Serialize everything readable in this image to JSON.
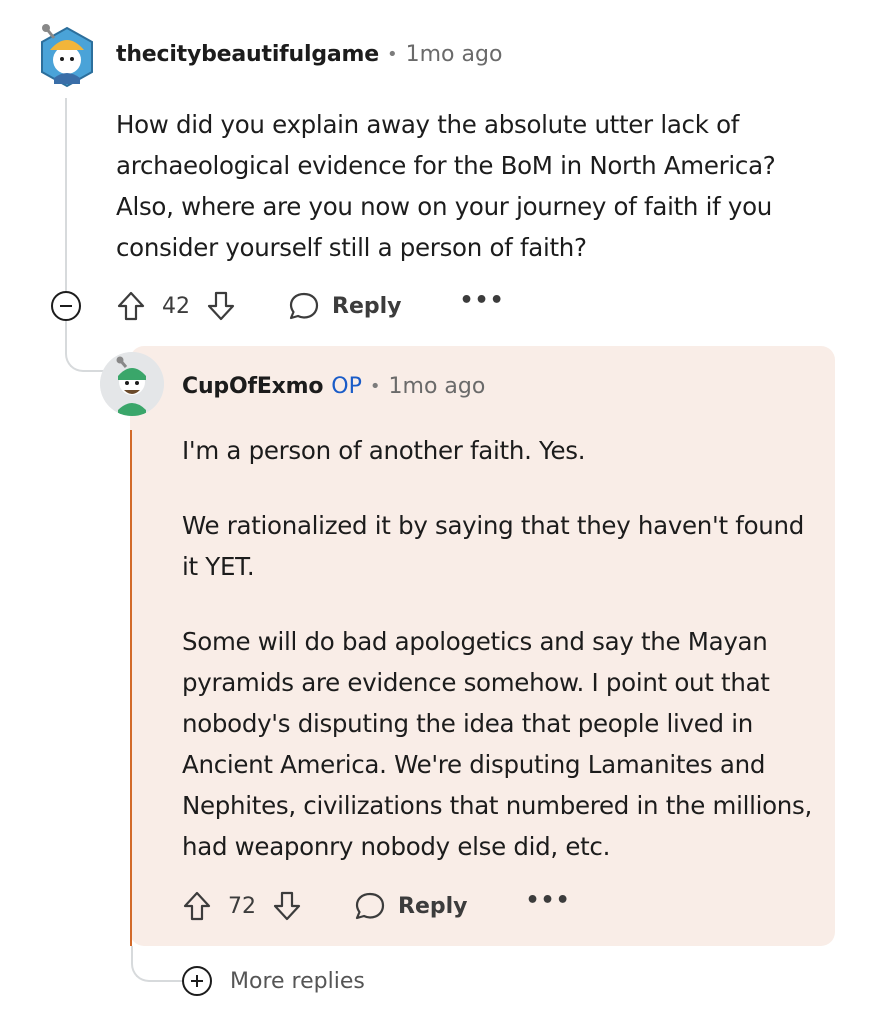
{
  "parent_comment": {
    "username": "thecitybeautifulgame",
    "timestamp": "1mo ago",
    "separator": "•",
    "body": [
      "How did you explain away the absolute utter lack of archaeological evidence for the BoM in North America? Also, where are you now on your journey of faith if you consider yourself still a person of faith?"
    ],
    "score": "42",
    "reply_label": "Reply",
    "more_label": "•••"
  },
  "reply_comment": {
    "username": "CupOfExmo",
    "op_badge": "OP",
    "timestamp": "1mo ago",
    "separator": "•",
    "body": [
      "I'm a person of another faith. Yes.",
      "We rationalized it by saying that they haven't found it YET.",
      "Some will do bad apologetics and say the Mayan pyramids are evidence somehow. I point out that nobody's disputing the idea that people lived in Ancient America. We're disputing Lamanites and Nephites, civilizations that numbered in the millions, had weaponry nobody else did, etc."
    ],
    "score": "72",
    "reply_label": "Reply",
    "more_label": "•••"
  },
  "more_replies_label": "More replies",
  "colors": {
    "highlight_background": "#f9ede7",
    "highlight_accent": "#d26a2a",
    "op_badge": "#1a5cc8",
    "thread_line": "#d7dadc"
  },
  "icons": {
    "collapse": "minus-circle-icon",
    "upvote": "arrow-up-icon",
    "downvote": "arrow-down-icon",
    "reply": "speech-bubble-icon",
    "more": "ellipsis-icon",
    "expand": "plus-circle-icon"
  }
}
